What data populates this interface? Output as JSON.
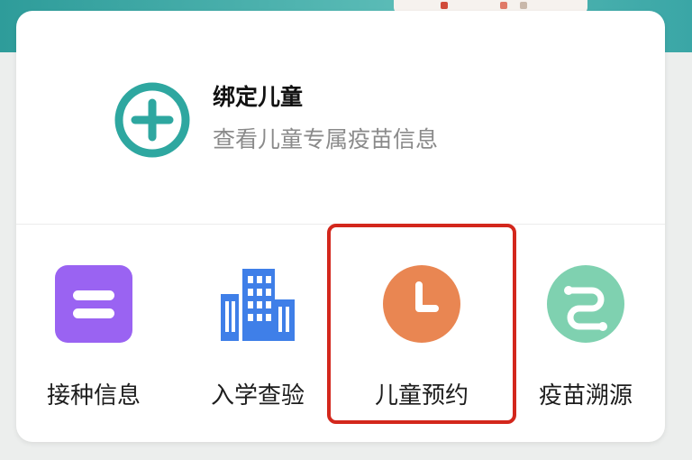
{
  "bind_child": {
    "title": "绑定儿童",
    "subtitle": "查看儿童专属疫苗信息",
    "icon": "plus-circle-icon"
  },
  "shortcuts": [
    {
      "label": "接种信息",
      "icon": "vaccination-info-icon",
      "color": "#9a63f2"
    },
    {
      "label": "入学查验",
      "icon": "school-building-icon",
      "color": "#3f7fe8"
    },
    {
      "label": "儿童预约",
      "icon": "clock-icon",
      "color": "#e98652",
      "highlighted": true
    },
    {
      "label": "疫苗溯源",
      "icon": "trace-route-icon",
      "color": "#7fd1b0"
    }
  ],
  "colors": {
    "accent": "#2ea7a0",
    "highlight": "#d3271c"
  }
}
